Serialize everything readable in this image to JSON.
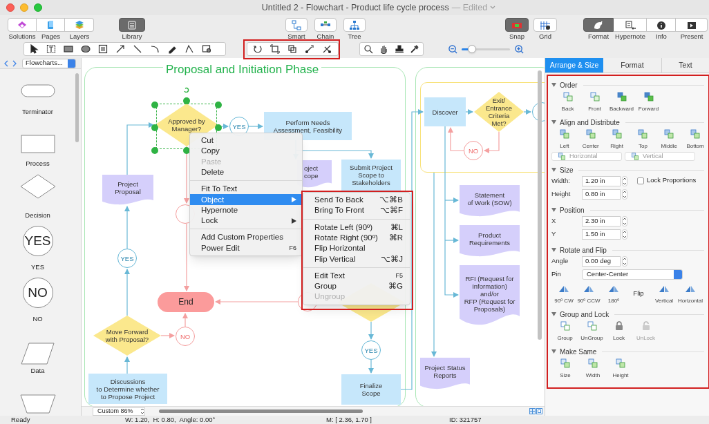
{
  "window": {
    "title": "Untitled 2 - Flowchart - Product life cycle process",
    "edited": "— Edited"
  },
  "toolbar": [
    {
      "label": "Solutions",
      "selected": false
    },
    {
      "label": "Pages",
      "selected": false
    },
    {
      "label": "Layers",
      "selected": false
    },
    {
      "label": "Library",
      "selected": true
    },
    {
      "label": "Smart",
      "selected": false
    },
    {
      "label": "Chain",
      "selected": false
    },
    {
      "label": "Tree",
      "selected": false
    },
    {
      "label": "Snap",
      "selected": true
    },
    {
      "label": "Grid",
      "selected": false
    },
    {
      "label": "Format",
      "selected": true
    },
    {
      "label": "Hypernote",
      "selected": false
    },
    {
      "label": "Info",
      "selected": false
    },
    {
      "label": "Present",
      "selected": false
    }
  ],
  "zoom_slider": {
    "level": 0.22
  },
  "library": {
    "dropdown": "Flowcharts...",
    "shapes": [
      {
        "kind": "terminator",
        "label": "Terminator"
      },
      {
        "kind": "process",
        "label": "Process"
      },
      {
        "kind": "decision",
        "label": "Decision"
      },
      {
        "kind": "yes",
        "label": "YES",
        "glyph": "YES"
      },
      {
        "kind": "no",
        "label": "NO",
        "glyph": "NO"
      },
      {
        "kind": "data",
        "label": "Data"
      },
      {
        "kind": "manual"
      }
    ]
  },
  "canvas": {
    "phase_title": "Proposal and Initiation Phase",
    "nodes": [
      {
        "kind": "decision",
        "text": "Approved by\nManager?",
        "selected": true
      },
      {
        "kind": "yes",
        "text": "YES",
        "selected": false
      },
      {
        "kind": "process",
        "text": "Perform Needs\nAssessment, Feasibility",
        "selected": false
      },
      {
        "kind": "document",
        "text": "oject\ncope",
        "selected": false
      },
      {
        "kind": "process",
        "text": "Submit Project\nScope to\nStakeholders",
        "selected": false
      },
      {
        "kind": "document",
        "text": "Project\nProposal",
        "selected": false
      },
      {
        "kind": "no",
        "selected": false
      },
      {
        "kind": "yes",
        "text": "YES",
        "selected": false
      },
      {
        "kind": "terminator",
        "text": "End",
        "selected": false
      },
      {
        "kind": "no",
        "text": "NO",
        "selected": false
      },
      {
        "kind": "decision",
        "text": "Move Forward\nwith Proposal?",
        "selected": false
      },
      {
        "kind": "process",
        "text": "Discussions\nto Determine whether\nto Propose Project",
        "selected": false
      },
      {
        "kind": "no",
        "selected": false
      },
      {
        "kind": "decision",
        "selected": false
      },
      {
        "kind": "yes",
        "text": "YES",
        "selected": false
      },
      {
        "kind": "process",
        "text": "Finalize\nScope",
        "selected": false
      },
      {
        "kind": "process",
        "text": "Discover",
        "selected": false
      },
      {
        "kind": "decision",
        "text": "Exit/\nEntrance\nCriteria\nMet?",
        "selected": false
      },
      {
        "kind": "yes",
        "selected": false
      },
      {
        "kind": "no",
        "text": "NO",
        "selected": false
      },
      {
        "kind": "document",
        "text": "Statement\nof Work (SOW)",
        "selected": false
      },
      {
        "kind": "document",
        "text": "Product\nRequirements",
        "selected": false
      },
      {
        "kind": "document",
        "text": "RFI (Request for\nInformation)\nand/or\nRFP (Request for\nProposals)",
        "selected": false
      },
      {
        "kind": "document",
        "text": "Project Status\nReports",
        "selected": false
      }
    ],
    "zoom": "Custom 86%"
  },
  "context_menu": [
    {
      "kind": "item",
      "label": "Cut",
      "disabled": false,
      "selected": false,
      "submenu": false
    },
    {
      "kind": "item",
      "label": "Copy",
      "disabled": false,
      "selected": false,
      "submenu": false
    },
    {
      "kind": "item",
      "label": "Paste",
      "disabled": true,
      "selected": false,
      "submenu": false
    },
    {
      "kind": "item",
      "label": "Delete",
      "disabled": false,
      "selected": false,
      "submenu": false
    },
    {
      "kind": "separator"
    },
    {
      "kind": "item",
      "label": "Fit To Text",
      "disabled": false,
      "selected": false,
      "submenu": false
    },
    {
      "kind": "item",
      "label": "Object",
      "disabled": false,
      "selected": true,
      "submenu": true
    },
    {
      "kind": "item",
      "label": "Hypernote",
      "disabled": false,
      "selected": false,
      "submenu": false
    },
    {
      "kind": "item",
      "label": "Lock",
      "disabled": false,
      "selected": false,
      "submenu": true
    },
    {
      "kind": "separator"
    },
    {
      "kind": "item",
      "label": "Add Custom Properties",
      "disabled": false,
      "selected": false,
      "submenu": false
    },
    {
      "kind": "item",
      "label": "Power Edit",
      "shortcut": "F6",
      "disabled": false,
      "selected": false,
      "submenu": false
    }
  ],
  "submenu": [
    {
      "kind": "item",
      "label": "Send To Back",
      "shortcut": "⌥⌘B",
      "disabled": false
    },
    {
      "kind": "item",
      "label": "Bring To Front",
      "shortcut": "⌥⌘F",
      "disabled": false
    },
    {
      "kind": "separator"
    },
    {
      "kind": "item",
      "label": "Rotate Left (90º)",
      "shortcut": "⌘L",
      "disabled": false
    },
    {
      "kind": "item",
      "label": "Rotate Right (90º)",
      "shortcut": "⌘R",
      "disabled": false
    },
    {
      "kind": "item",
      "label": "Flip Horizontal",
      "disabled": false
    },
    {
      "kind": "item",
      "label": "Flip Vertical",
      "shortcut": "⌥⌘J",
      "disabled": false
    },
    {
      "kind": "separator"
    },
    {
      "kind": "item",
      "label": "Edit Text",
      "shortcut": "F5",
      "disabled": false
    },
    {
      "kind": "item",
      "label": "Group",
      "shortcut": "⌘G",
      "disabled": false
    },
    {
      "kind": "item",
      "label": "Ungroup",
      "disabled": true
    }
  ],
  "panel": {
    "tabs": [
      {
        "label": "Arrange & Size",
        "selected": true
      },
      {
        "label": "Format",
        "selected": false
      },
      {
        "label": "Text",
        "selected": false
      }
    ],
    "order": {
      "title": "Order",
      "buttons": [
        "Back",
        "Front",
        "Backward",
        "Forward"
      ]
    },
    "align": {
      "title": "Align and Distribute",
      "buttons": [
        "Left",
        "Center",
        "Right",
        "Top",
        "Middle",
        "Bottom"
      ],
      "selects": [
        {
          "value": "Horizontal",
          "disabled": true
        },
        {
          "value": "Vertical",
          "disabled": true
        }
      ]
    },
    "size": {
      "title": "Size",
      "fields": [
        {
          "label": "Width:",
          "value": "1.20 in"
        },
        {
          "label": "Height",
          "value": "0.80 in"
        }
      ],
      "lock": {
        "label": "Lock Proportions",
        "checked": false
      }
    },
    "position": {
      "title": "Position",
      "fields": [
        {
          "label": "X",
          "value": "2.30 in"
        },
        {
          "label": "Y",
          "value": "1.50 in"
        }
      ]
    },
    "rotate": {
      "title": "Rotate and Flip",
      "angle": {
        "label": "Angle",
        "value": "0.00 deg"
      },
      "pin": {
        "label": "Pin",
        "value": "Center-Center"
      },
      "buttons": [
        {
          "kind": "button",
          "label": "90º CW"
        },
        {
          "kind": "button",
          "label": "90º CCW"
        },
        {
          "kind": "button",
          "label": "180º"
        },
        {
          "kind": "label",
          "label": "Flip"
        },
        {
          "kind": "button",
          "label": "Vertical"
        },
        {
          "kind": "button",
          "label": "Horizontal"
        }
      ]
    },
    "group": {
      "title": "Group and Lock",
      "buttons": [
        {
          "label": "Group",
          "disabled": false
        },
        {
          "label": "UnGroup",
          "disabled": false
        },
        {
          "label": "Lock",
          "disabled": false
        },
        {
          "label": "UnLock",
          "disabled": true
        }
      ]
    },
    "same": {
      "title": "Make Same",
      "buttons": [
        "Size",
        "Width",
        "Height"
      ]
    }
  },
  "status_bar": {
    "state": "Ready",
    "size": "W: 1.20,  H: 0.80,  Angle: 0.00°",
    "mouse": "M: [ 2.36, 1.70 ]",
    "id": "ID: 321757"
  }
}
